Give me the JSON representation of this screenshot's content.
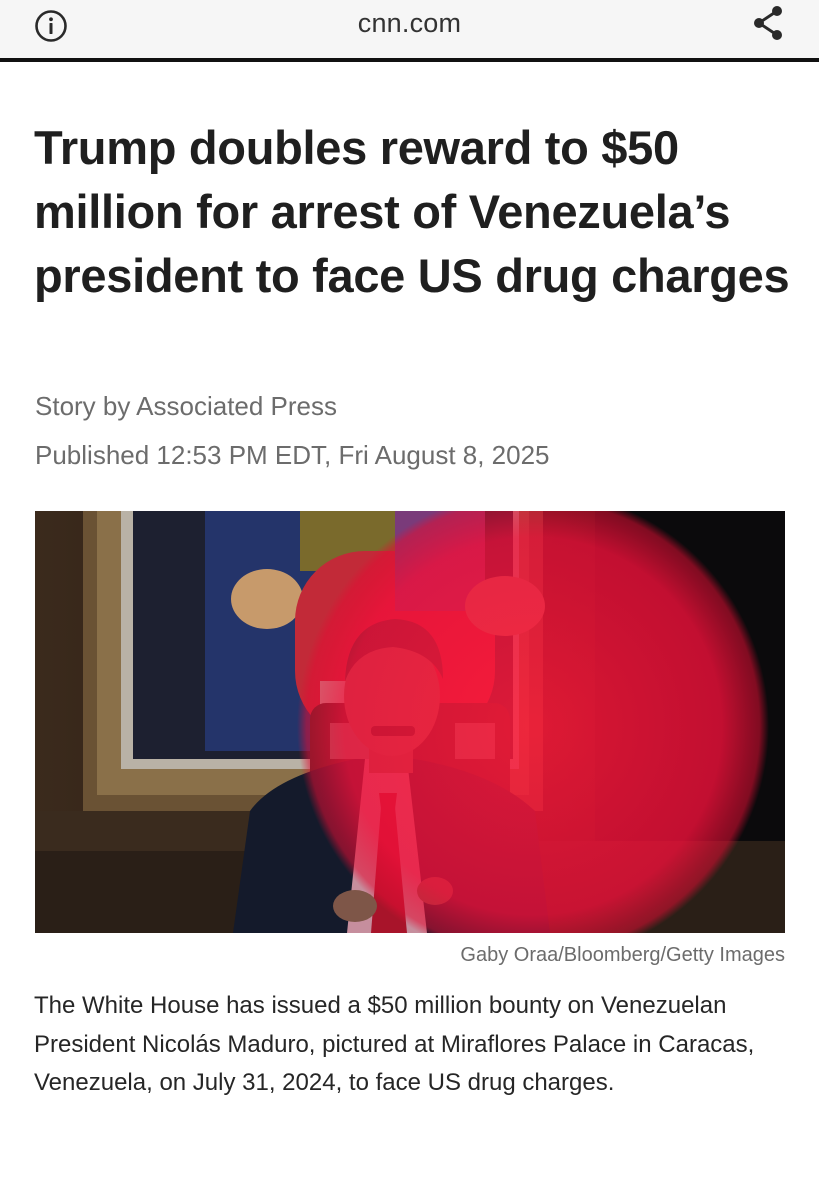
{
  "browser": {
    "url": "cnn.com",
    "info_icon": "info-icon",
    "share_icon": "share-icon"
  },
  "article": {
    "headline": "Trump doubles reward to $50 million for arrest of Venezuela’s president to face US drug charges",
    "byline": "Story by Associated Press",
    "published": "Published 12:53 PM EDT, Fri August 8, 2025",
    "image_credit": "Gaby Oraa/Bloomberg/Getty Images",
    "caption": "The White House has issued a $50 million bounty on Venezuelan President Nicolás Maduro, pictured at Miraflores Palace in Caracas, Venezuela, on July 31, 2024, to face US drug charges."
  },
  "colors": {
    "text": "#1f1f1f",
    "meta_text": "#6c6c6c",
    "topbar_bg": "#f6f6f6",
    "red_overlay": "#e8163c"
  }
}
